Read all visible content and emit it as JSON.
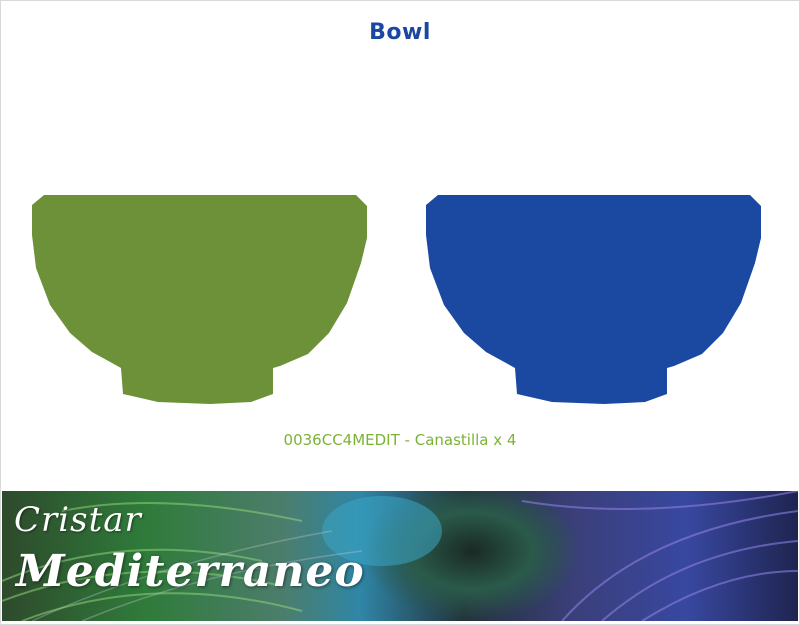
{
  "title": "Bowl",
  "product_code": "0036CC4MEDIT - Canastilla x 4",
  "products": [
    {
      "name": "green-bowl",
      "color": "#6c9139"
    },
    {
      "name": "blue-bowl",
      "color": "#1b49a1"
    }
  ],
  "brand": {
    "line1": "Cristar",
    "line2": "Mediterraneo"
  },
  "colors": {
    "title": "#1a48a0",
    "caption": "#7cb236"
  }
}
